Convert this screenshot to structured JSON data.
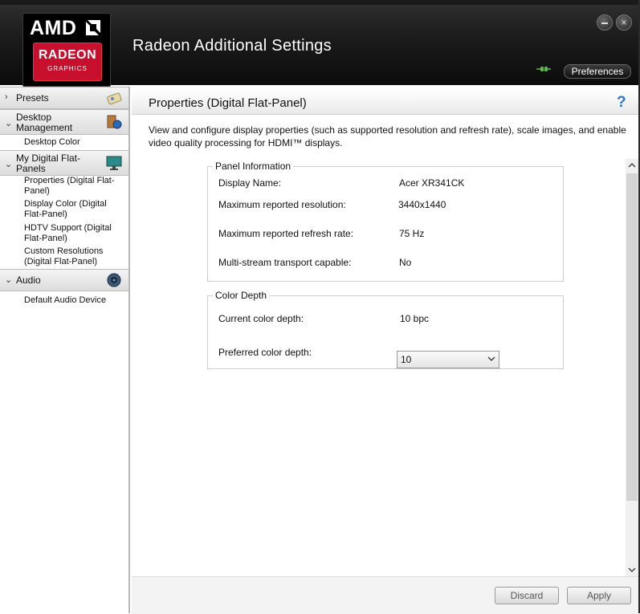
{
  "app": {
    "title": "Radeon Additional Settings",
    "logo_text_1": "AMD",
    "logo_text_2": "RADEON",
    "logo_text_3": "GRAPHICS",
    "preferences_label": "Preferences",
    "min_icon": "minimize-icon",
    "close_icon": "close-icon"
  },
  "sidebar": {
    "presets": "Presets",
    "desktop_management": "Desktop Management",
    "desktop_color": "Desktop Color",
    "my_digital_flat_panels": "My Digital Flat-Panels",
    "items": [
      "Properties (Digital Flat-Panel)",
      "Display Color (Digital Flat-Panel)",
      "HDTV Support (Digital Flat-Panel)",
      "Custom Resolutions (Digital Flat-Panel)"
    ],
    "audio": "Audio",
    "default_audio_device": "Default Audio Device"
  },
  "main": {
    "page_title": "Properties (Digital Flat-Panel)",
    "help": "?",
    "description": "View and configure display properties (such as supported resolution and refresh rate), scale images, and enable video quality processing for HDMI™ displays.",
    "panel_info": {
      "title": "Panel Information",
      "display_name_label": "Display Name:",
      "display_name_value": "Acer XR341CK",
      "max_res_label": "Maximum reported resolution:",
      "max_res_value": "3440x1440",
      "max_refresh_label": "Maximum reported refresh rate:",
      "max_refresh_value": "75 Hz",
      "mst_label": "Multi-stream transport capable:",
      "mst_value": "No"
    },
    "color_depth": {
      "title": "Color Depth",
      "current_label": "Current color depth:",
      "current_value": "10 bpc",
      "preferred_label": "Preferred color depth:",
      "preferred_value": "10"
    },
    "discard": "Discard",
    "apply": "Apply"
  },
  "colors": {
    "amd_red": "#c8102e",
    "help_blue": "#2a77c8",
    "header_bg": "#1a1a1a"
  }
}
